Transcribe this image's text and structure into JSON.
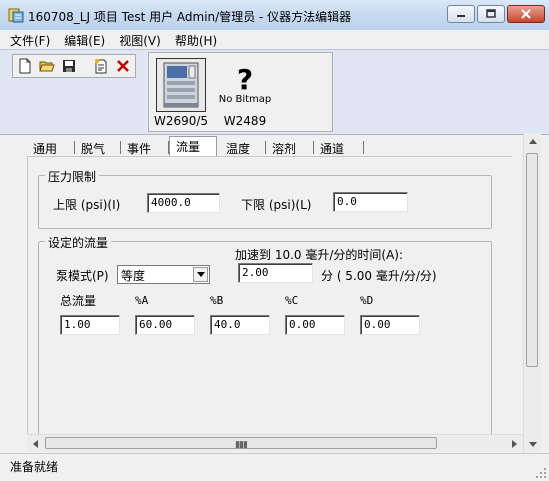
{
  "window": {
    "title": "160708_LJ 项目 Test 用户 Admin/管理员 - 仪器方法编辑器"
  },
  "menu": {
    "items": [
      "文件(F)",
      "编辑(E)",
      "视图(V)",
      "帮助(H)"
    ]
  },
  "toolbar": {
    "buttons": [
      "new-file-icon",
      "open-folder-icon",
      "save-icon",
      "properties-icon",
      "delete-x-icon"
    ]
  },
  "instruments": [
    {
      "label": "W2690/5",
      "image": "hplc-module-icon",
      "selected": true
    },
    {
      "label": "W2489",
      "image": "no-bitmap-icon",
      "bitmap_question": "?",
      "bitmap_text": "No Bitmap",
      "selected": false
    }
  ],
  "tabs": [
    "通用",
    "脱气",
    "事件",
    "流量",
    "温度",
    "溶剂",
    "通道"
  ],
  "active_tab": "流量",
  "pressure_limit": {
    "title": "压力限制",
    "upper_label": "上限 (psi)(I)",
    "upper_value": "4000.0",
    "lower_label": "下限 (psi)(L)",
    "lower_value": "0.0"
  },
  "flow": {
    "title": "设定的流量",
    "ramp_label": "加速到 10.0 毫升/分的时间(A):",
    "ramp_value": "2.00",
    "ramp_unit": "分 (  5.00 毫升/分/分)",
    "pump_mode_label": "泵模式(P)",
    "pump_mode_value": "等度",
    "columns": {
      "total": "总流量",
      "a": "%A",
      "b": "%B",
      "c": "%C",
      "d": "%D"
    },
    "values": {
      "total": "1.00",
      "a": "60.00",
      "b": "40.0",
      "c": "0.00",
      "d": "0.00"
    }
  },
  "status": {
    "text": "准备就绪"
  }
}
